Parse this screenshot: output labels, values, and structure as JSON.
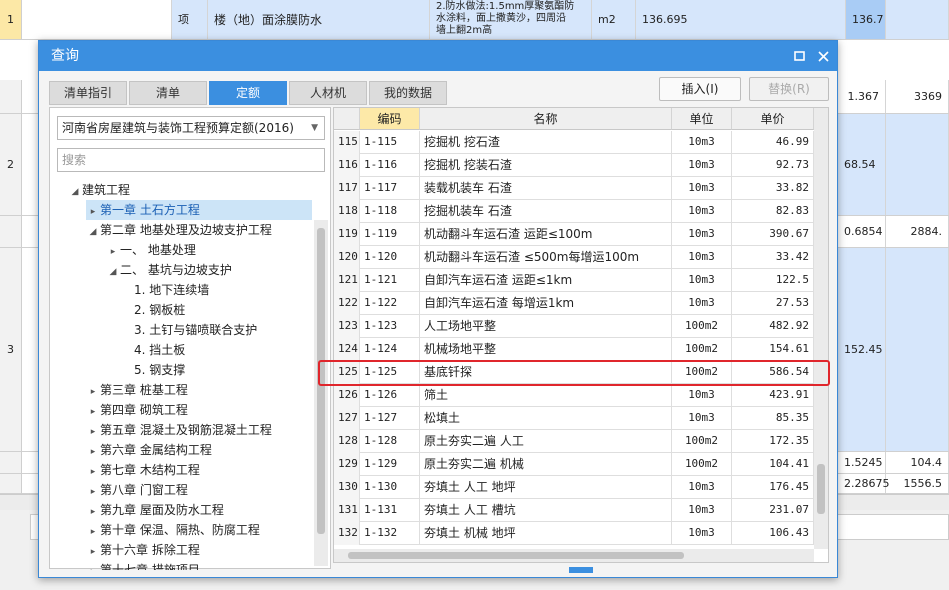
{
  "background": {
    "rows": [
      {
        "num": "1",
        "unit_label": "项",
        "name": "楼（地）面涂膜防水",
        "desc1": "2.防水做法:1.5mm厚聚氨酯防",
        "desc2": "水涂料，面上撒黄沙，四周沿",
        "desc3": "墙上翻2m高",
        "unit": "m2",
        "qty": "136.695",
        "total": "136.7"
      },
      {
        "num": "",
        "v1": "1.367",
        "v2": "3369"
      },
      {
        "num": "2",
        "v1": "68.54"
      },
      {
        "num": "",
        "v1": "0.6854",
        "v2": "2884."
      },
      {
        "num": "3",
        "v1": "152.45"
      },
      {
        "num": "",
        "v1": "1.5245",
        "v2": "104.4"
      },
      {
        "num": "",
        "v1": "2.28675",
        "v2": "1556.5"
      }
    ]
  },
  "dialog": {
    "title": "查询",
    "tabs": [
      "清单指引",
      "清单",
      "定额",
      "人材机",
      "我的数据"
    ],
    "active_tab": "定额",
    "insert_button": "插入(I)",
    "replace_button": "替换(R)",
    "quota_select": "河南省房屋建筑与装饰工程预算定额(2016)",
    "search_placeholder": "搜索",
    "tree": [
      {
        "label": "建筑工程",
        "level": 0,
        "arrow": "expanded"
      },
      {
        "label": "第一章 土石方工程",
        "level": 1,
        "arrow": "collapsed",
        "selected": true
      },
      {
        "label": "第二章 地基处理及边坡支护工程",
        "level": 1,
        "arrow": "expanded"
      },
      {
        "label": "一、 地基处理",
        "level": 2,
        "arrow": "collapsed"
      },
      {
        "label": "二、 基坑与边坡支护",
        "level": 2,
        "arrow": "expanded"
      },
      {
        "label": "1. 地下连续墙",
        "level": 3,
        "arrow": "none"
      },
      {
        "label": "2. 钢板桩",
        "level": 3,
        "arrow": "none"
      },
      {
        "label": "3. 土钉与锚喷联合支护",
        "level": 3,
        "arrow": "none"
      },
      {
        "label": "4. 挡土板",
        "level": 3,
        "arrow": "none"
      },
      {
        "label": "5. 钢支撑",
        "level": 3,
        "arrow": "none"
      },
      {
        "label": "第三章 桩基工程",
        "level": 1,
        "arrow": "collapsed"
      },
      {
        "label": "第四章 砌筑工程",
        "level": 1,
        "arrow": "collapsed"
      },
      {
        "label": "第五章 混凝土及钢筋混凝土工程",
        "level": 1,
        "arrow": "collapsed"
      },
      {
        "label": "第六章 金属结构工程",
        "level": 1,
        "arrow": "collapsed"
      },
      {
        "label": "第七章 木结构工程",
        "level": 1,
        "arrow": "collapsed"
      },
      {
        "label": "第八章 门窗工程",
        "level": 1,
        "arrow": "collapsed"
      },
      {
        "label": "第九章 屋面及防水工程",
        "level": 1,
        "arrow": "collapsed"
      },
      {
        "label": "第十章 保温、隔热、防腐工程",
        "level": 1,
        "arrow": "collapsed"
      },
      {
        "label": "第十六章 拆除工程",
        "level": 1,
        "arrow": "collapsed"
      },
      {
        "label": "第十七章 措施项目",
        "level": 1,
        "arrow": "collapsed"
      }
    ],
    "table": {
      "columns": [
        "",
        "编码",
        "名称",
        "单位",
        "单价"
      ],
      "rows": [
        [
          "115",
          "1-115",
          "挖掘机 挖石渣",
          "10m3",
          "46.99"
        ],
        [
          "116",
          "1-116",
          "挖掘机 挖装石渣",
          "10m3",
          "92.73"
        ],
        [
          "117",
          "1-117",
          "装载机装车 石渣",
          "10m3",
          "33.82"
        ],
        [
          "118",
          "1-118",
          "挖掘机装车 石渣",
          "10m3",
          "82.83"
        ],
        [
          "119",
          "1-119",
          "机动翻斗车运石渣 运距≤100m",
          "10m3",
          "390.67"
        ],
        [
          "120",
          "1-120",
          "机动翻斗车运石渣 ≤500m每增运100m",
          "10m3",
          "33.42"
        ],
        [
          "121",
          "1-121",
          "自卸汽车运石渣 运距≤1km",
          "10m3",
          "122.5"
        ],
        [
          "122",
          "1-122",
          "自卸汽车运石渣 每增运1km",
          "10m3",
          "27.53"
        ],
        [
          "123",
          "1-123",
          "人工场地平整",
          "100m2",
          "482.92"
        ],
        [
          "124",
          "1-124",
          "机械场地平整",
          "100m2",
          "154.61"
        ],
        [
          "125",
          "1-125",
          "基底钎探",
          "100m2",
          "586.54"
        ],
        [
          "126",
          "1-126",
          "筛土",
          "10m3",
          "423.91"
        ],
        [
          "127",
          "1-127",
          "松填土",
          "10m3",
          "85.35"
        ],
        [
          "128",
          "1-128",
          "原土夯实二遍 人工",
          "100m2",
          "172.35"
        ],
        [
          "129",
          "1-129",
          "原土夯实二遍 机械",
          "100m2",
          "104.41"
        ],
        [
          "130",
          "1-130",
          "夯填土 人工 地坪",
          "10m3",
          "176.45"
        ],
        [
          "131",
          "1-131",
          "夯填土 人工 槽坑",
          "10m3",
          "231.07"
        ],
        [
          "132",
          "1-132",
          "夯填土 机械 地坪",
          "10m3",
          "106.43"
        ]
      ],
      "highlighted_row": "125"
    }
  }
}
